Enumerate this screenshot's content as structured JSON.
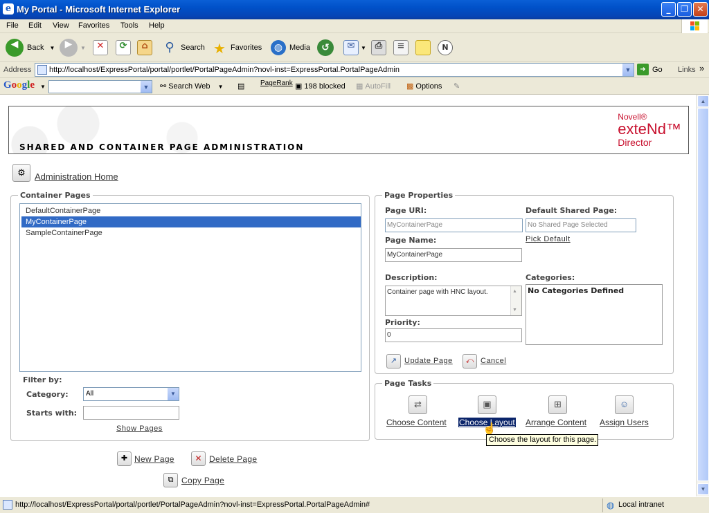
{
  "window": {
    "title": "My Portal - Microsoft Internet Explorer",
    "min": "_",
    "max": "❐",
    "close": "✕"
  },
  "menu": [
    "File",
    "Edit",
    "View",
    "Favorites",
    "Tools",
    "Help"
  ],
  "toolbar": {
    "back": "Back",
    "search": "Search",
    "favorites": "Favorites",
    "media": "Media"
  },
  "address": {
    "label": "Address",
    "url": "http://localhost/ExpressPortal/portal/portlet/PortalPageAdmin?novl-inst=ExpressPortal.PortalPageAdmin",
    "go": "Go",
    "links": "Links",
    "more": "»"
  },
  "google": {
    "logo": "Google",
    "search_web": "Search Web",
    "pagerank": "PageRank",
    "blocked": "198 blocked",
    "autofill": "AutoFill",
    "options": "Options"
  },
  "banner": {
    "heading": "SHARED AND CONTAINER PAGE ADMINISTRATION",
    "brand1": "Novell®",
    "brand2": "exteNd™",
    "brand3": "Director"
  },
  "admin_home": "Administration Home",
  "container_pages": {
    "legend": "Container Pages",
    "items": [
      "DefaultContainerPage",
      "MyContainerPage",
      "SampleContainerPage"
    ],
    "selected": "MyContainerPage",
    "filter_by": "Filter by:",
    "category_label": "Category:",
    "category_value": "All",
    "starts_with_label": "Starts with:",
    "starts_with_value": "",
    "show_pages": "Show Pages"
  },
  "page_properties": {
    "legend": "Page Properties",
    "uri_label": "Page URI:",
    "uri_value": "MyContainerPage",
    "default_shared_label": "Default Shared Page:",
    "default_shared_value": "No Shared Page Selected",
    "pick_default": "Pick Default",
    "name_label": "Page Name:",
    "name_value": "MyContainerPage",
    "description_label": "Description:",
    "description_value": "Container page with HNC layout.",
    "categories_label": "Categories:",
    "categories_value": "No Categories Defined",
    "priority_label": "Priority:",
    "priority_value": "0",
    "update": "Update Page",
    "cancel": "Cancel"
  },
  "page_tasks": {
    "legend": "Page Tasks",
    "choose_content": "Choose Content",
    "choose_layout": "Choose Layout",
    "arrange_content": "Arrange Content",
    "assign_users": "Assign Users",
    "tooltip": "Choose the layout for this page."
  },
  "actions": {
    "new_page": "New Page",
    "delete_page": "Delete Page",
    "copy_page": "Copy Page"
  },
  "status": {
    "message": "http://localhost/ExpressPortal/portal/portlet/PortalPageAdmin?novl-inst=ExpressPortal.PortalPageAdmin#",
    "zone": "Local intranet"
  }
}
